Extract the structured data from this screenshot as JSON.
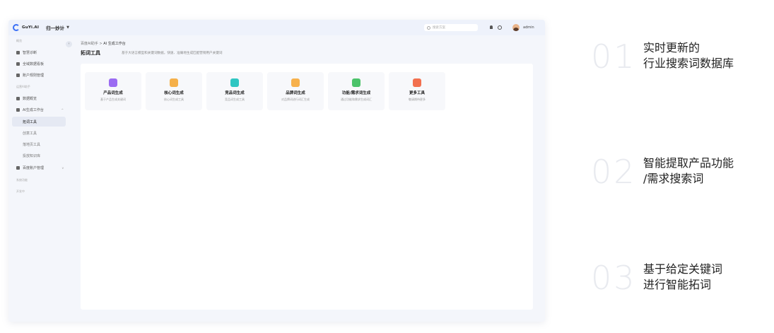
{
  "app": {
    "logo_text": "GuYi.AI",
    "team_name": "归一妙计",
    "search_placeholder": "搜索方案",
    "username": "admin"
  },
  "sidebar": {
    "group1": "概览",
    "items": [
      {
        "label": "智慧诊断"
      },
      {
        "label": "全域数据看板"
      },
      {
        "label": "账户规则管理"
      }
    ],
    "group2": "运营AI助手",
    "item4": "数据概览",
    "ai_group": "AI生成工作台",
    "sub_items": [
      "拓词工具",
      "创意工具",
      "落地页工具",
      "投放知识库"
    ],
    "item_assets": "百度账户管理",
    "group3": "系统功能",
    "group4": "开发中"
  },
  "main": {
    "breadcrumb_root": "百度AI助手",
    "breadcrumb_sep": ">",
    "breadcrumb_current": "AI 生成工作台",
    "title": "拓词工具",
    "description": "基于大语言模型和关键词数据，快速、准确地生成匹配营销用户关键词"
  },
  "cards": [
    {
      "title": "产品词生成",
      "desc": "基于产品生成关键词",
      "color": "#9b6cf2"
    },
    {
      "title": "核心词生成",
      "desc": "核心词生成工具",
      "color": "#f5b04a"
    },
    {
      "title": "竞品词生成",
      "desc": "竞品词生成工具",
      "color": "#2fc6c2"
    },
    {
      "title": "品牌词生成",
      "desc": "对品牌词进行词汇生成",
      "color": "#f7b14c"
    },
    {
      "title": "功能/需求词生成",
      "desc": "通过功能和需求生成词汇",
      "color": "#4cc36a"
    },
    {
      "title": "更多工具",
      "desc": "敬请期待更多",
      "color": "#f2704f"
    }
  ],
  "features": [
    {
      "num": "01",
      "line1": "实时更新的",
      "line2": "行业搜索词数据库"
    },
    {
      "num": "02",
      "line1": "智能提取产品功能",
      "line2": "/需求搜索词"
    },
    {
      "num": "03",
      "line1": "基于给定关键词",
      "line2": "进行智能拓词"
    }
  ]
}
